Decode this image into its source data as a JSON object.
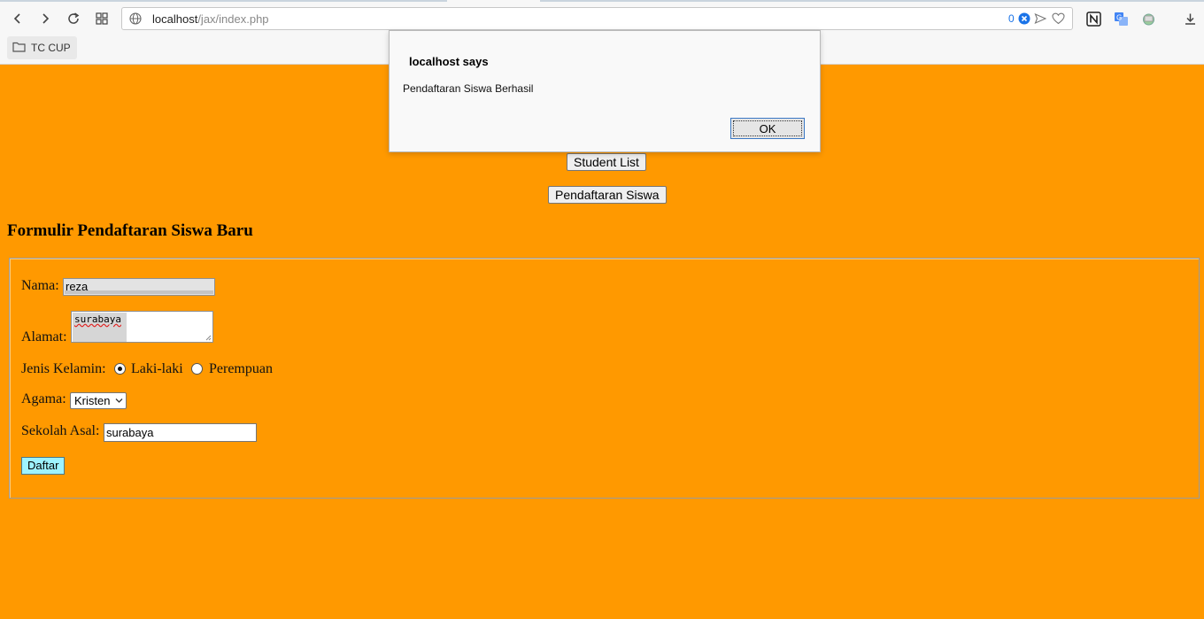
{
  "browser": {
    "url_host": "localhost",
    "url_path": "/jax/index.php",
    "badge_count": "0",
    "bookmark": {
      "label": "TC CUP"
    }
  },
  "page": {
    "student_list_label": "Student List",
    "pendaftaran_label": "Pendaftaran Siswa",
    "form_title": "Formulir Pendaftaran Siswa Baru",
    "form": {
      "nama_label": "Nama:",
      "nama_value": "reza",
      "alamat_label": "Alamat:",
      "alamat_value": "surabaya",
      "gender_label": "Jenis Kelamin:",
      "gender_options": [
        "Laki-laki",
        "Perempuan"
      ],
      "gender_selected": "Laki-laki",
      "agama_label": "Agama:",
      "agama_value": "Kristen",
      "sekolah_label": "Sekolah Asal:",
      "sekolah_value": "surabaya",
      "submit_label": "Daftar"
    }
  },
  "alert": {
    "title": "localhost says",
    "message": "Pendaftaran Siswa Berhasil",
    "ok_label": "OK"
  },
  "colors": {
    "page_background": "#ff9900",
    "submit_button": "#9ef3ff",
    "badge": "#1a73e8"
  }
}
